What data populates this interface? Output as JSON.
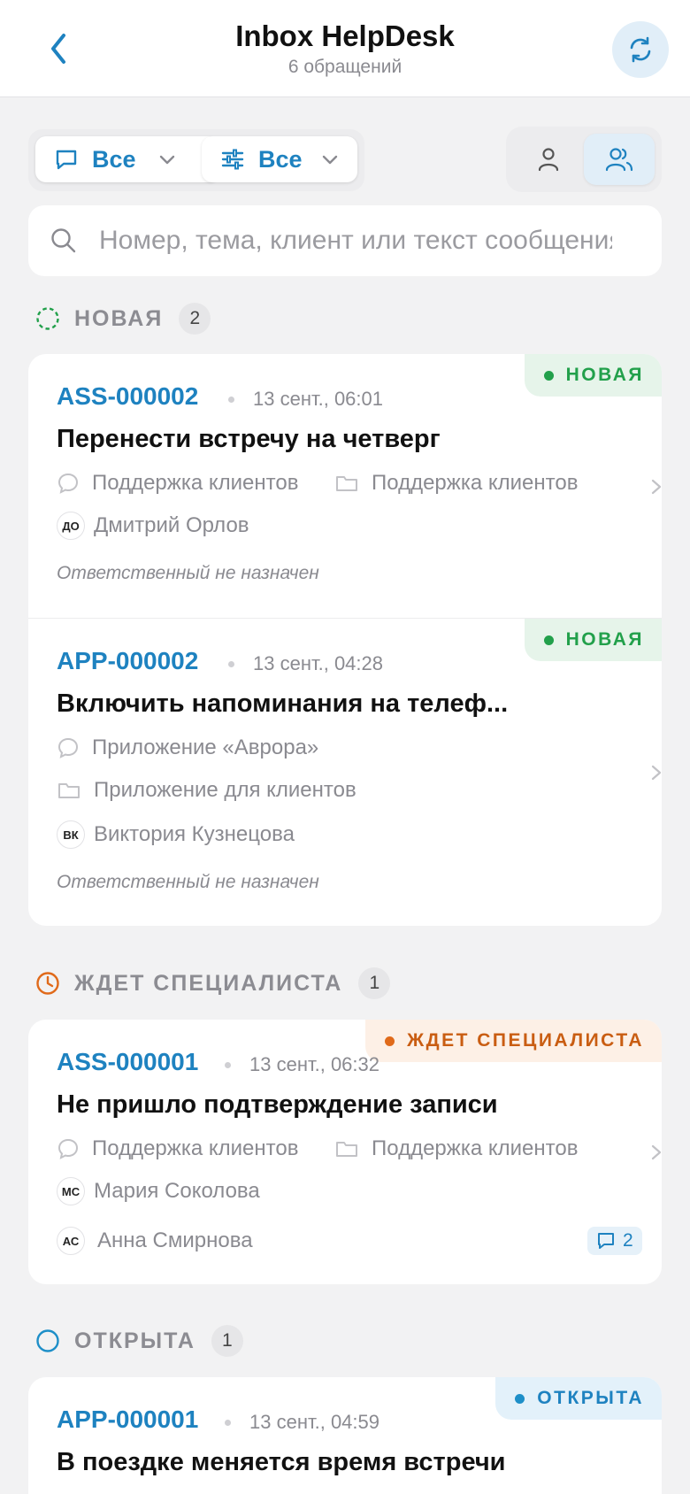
{
  "header": {
    "title": "Inbox HelpDesk",
    "subtitle": "6 обращений",
    "back_icon": "chevron-left-icon",
    "refresh_icon": "refresh-icon"
  },
  "filters": {
    "channel_label": "Все",
    "params_label": "Все",
    "view_mode_selected": "team"
  },
  "search": {
    "placeholder": "Номер, тема, клиент или текст сообщения"
  },
  "colors": {
    "accent": "#1e82c0",
    "new": "#22a04b",
    "waiting": "#e06a1a",
    "open": "#1e8fc8"
  },
  "sections": [
    {
      "title": "НОВАЯ",
      "count": "2",
      "tickets": [
        {
          "id": "ASS-000002",
          "date": "13 сент., 06:01",
          "status": "НОВАЯ",
          "title": "Перенести встречу на четверг",
          "channel": "Поддержка клиентов",
          "queue": "Поддержка клиентов",
          "client_initials": "ДО",
          "client": "Дмитрий Орлов",
          "assignee": "Ответственный не назначен"
        },
        {
          "id": "APP-000002",
          "date": "13 сент., 04:28",
          "status": "НОВАЯ",
          "title": "Включить напоминания на телеф...",
          "channel": "Приложение «Аврора»",
          "queue": "Приложение для клиентов",
          "client_initials": "ВК",
          "client": "Виктория Кузнецова",
          "assignee": "Ответственный не назначен"
        }
      ]
    },
    {
      "title": "ЖДЕТ СПЕЦИАЛИСТА",
      "count": "1",
      "tickets": [
        {
          "id": "ASS-000001",
          "date": "13 сент., 06:32",
          "status": "ЖДЕТ СПЕЦИАЛИСТА",
          "title": "Не пришло подтверждение записи",
          "channel": "Поддержка клиентов",
          "queue": "Поддержка клиентов",
          "client_initials": "МС",
          "client": "Мария Соколова",
          "assignee_initials": "АС",
          "assignee": "Анна Смирнова",
          "comments": "2"
        }
      ]
    },
    {
      "title": "ОТКРЫТА",
      "count": "1",
      "tickets": [
        {
          "id": "APP-000001",
          "date": "13 сент., 04:59",
          "status": "ОТКРЫТА",
          "title": "В поездке меняется время встречи"
        }
      ]
    }
  ]
}
